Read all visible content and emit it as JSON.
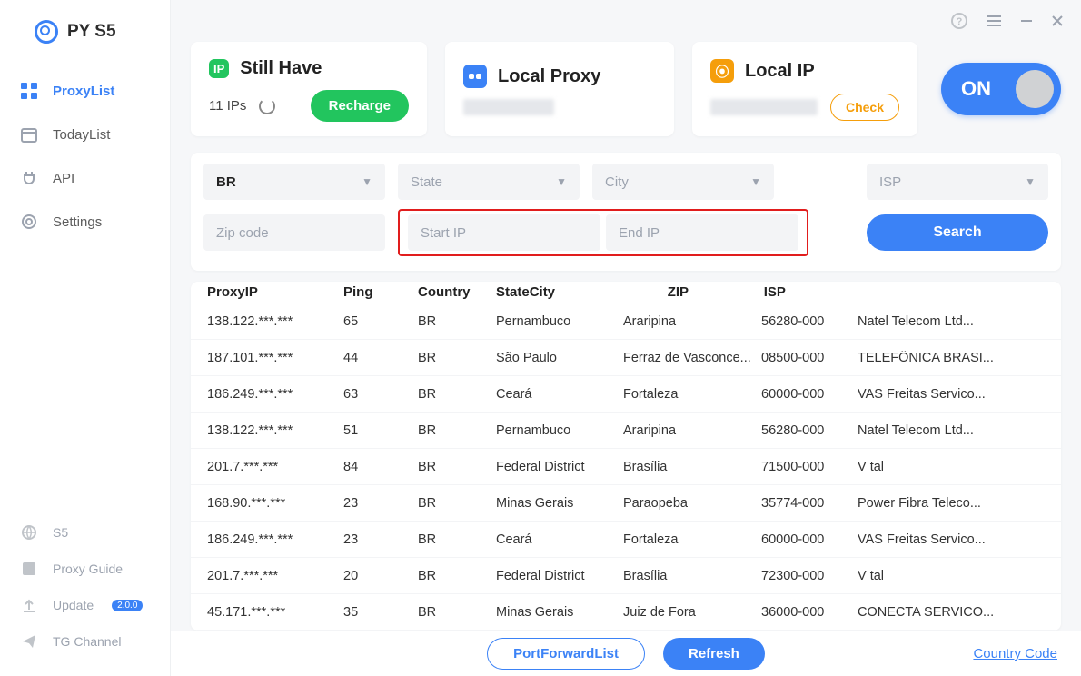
{
  "app_name": "PY S5",
  "sidebar": {
    "nav": [
      {
        "label": "ProxyList",
        "icon": "grid-icon",
        "active": true
      },
      {
        "label": "TodayList",
        "icon": "calendar-icon",
        "active": false
      },
      {
        "label": "API",
        "icon": "plug-icon",
        "active": false
      },
      {
        "label": "Settings",
        "icon": "gear-icon",
        "active": false
      }
    ],
    "bottom": [
      {
        "label": "S5",
        "icon": "globe-icon"
      },
      {
        "label": "Proxy Guide",
        "icon": "book-icon"
      },
      {
        "label": "Update",
        "icon": "upload-icon",
        "pill": "2.0.0"
      },
      {
        "label": "TG Channel",
        "icon": "send-icon"
      }
    ]
  },
  "cards": {
    "still_have": {
      "title": "Still Have",
      "count": "11 IPs",
      "recharge": "Recharge"
    },
    "local_proxy": {
      "title": "Local Proxy"
    },
    "local_ip": {
      "title": "Local IP",
      "check": "Check"
    },
    "toggle": {
      "label": "ON"
    }
  },
  "filters": {
    "country": "BR",
    "state_placeholder": "State",
    "city_placeholder": "City",
    "isp_placeholder": "ISP",
    "zip_placeholder": "Zip code",
    "start_ip_placeholder": "Start IP",
    "end_ip_placeholder": "End IP",
    "search": "Search"
  },
  "table": {
    "headers": {
      "ip": "ProxyIP",
      "ping": "Ping",
      "country": "Country",
      "state": "State",
      "city": "City",
      "zip": "ZIP",
      "isp": "ISP"
    },
    "rows": [
      {
        "ip": "138.122.***.***",
        "ping": "65",
        "country": "BR",
        "state": "Pernambuco",
        "city": "Araripina",
        "zip": "56280-000",
        "isp": "Natel Telecom Ltd..."
      },
      {
        "ip": "187.101.***.***",
        "ping": "44",
        "country": "BR",
        "state": "São Paulo",
        "city": "Ferraz de Vasconce...",
        "zip": "08500-000",
        "isp": "TELEFÔNICA BRASI..."
      },
      {
        "ip": "186.249.***.***",
        "ping": "63",
        "country": "BR",
        "state": "Ceará",
        "city": "Fortaleza",
        "zip": "60000-000",
        "isp": "VAS Freitas Servico..."
      },
      {
        "ip": "138.122.***.***",
        "ping": "51",
        "country": "BR",
        "state": "Pernambuco",
        "city": "Araripina",
        "zip": "56280-000",
        "isp": "Natel Telecom Ltd..."
      },
      {
        "ip": "201.7.***.***",
        "ping": "84",
        "country": "BR",
        "state": "Federal District",
        "city": "Brasília",
        "zip": "71500-000",
        "isp": "V tal"
      },
      {
        "ip": "168.90.***.***",
        "ping": "23",
        "country": "BR",
        "state": "Minas Gerais",
        "city": "Paraopeba",
        "zip": "35774-000",
        "isp": "Power Fibra Teleco..."
      },
      {
        "ip": "186.249.***.***",
        "ping": "23",
        "country": "BR",
        "state": "Ceará",
        "city": "Fortaleza",
        "zip": "60000-000",
        "isp": "VAS Freitas Servico..."
      },
      {
        "ip": "201.7.***.***",
        "ping": "20",
        "country": "BR",
        "state": "Federal District",
        "city": "Brasília",
        "zip": "72300-000",
        "isp": "V tal"
      },
      {
        "ip": "45.171.***.***",
        "ping": "35",
        "country": "BR",
        "state": "Minas Gerais",
        "city": "Juiz de Fora",
        "zip": "36000-000",
        "isp": "CONECTA SERVICO..."
      }
    ]
  },
  "footer": {
    "pfl": "PortForwardList",
    "refresh": "Refresh",
    "cc": "Country Code"
  }
}
